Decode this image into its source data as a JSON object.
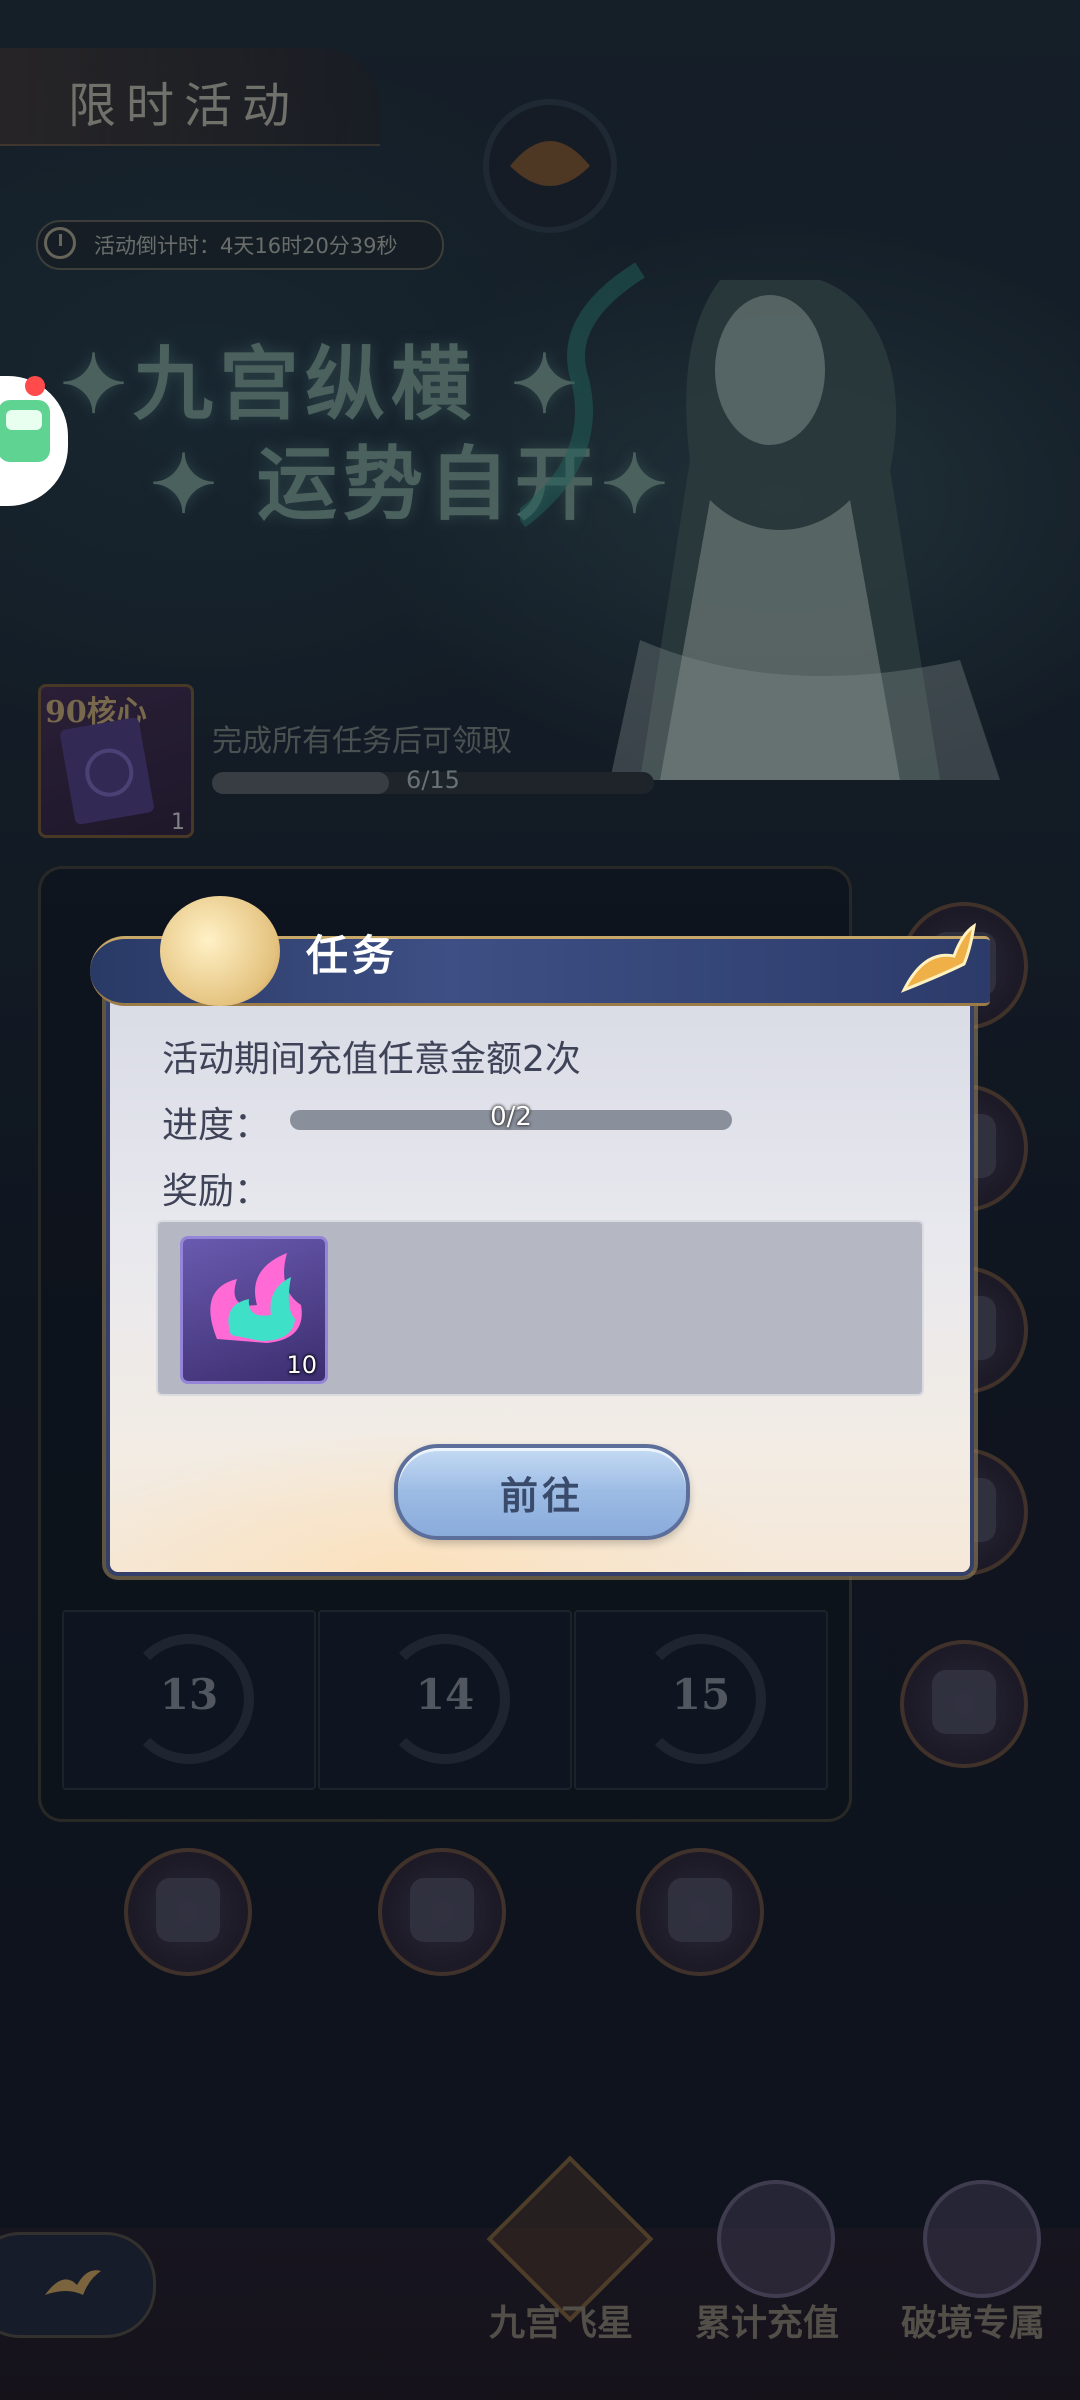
{
  "header": {
    "title": "限时活动",
    "countdown": "活动倒计时：4天16时20分39秒"
  },
  "slogan": {
    "line1": "✦九宫纵横 ✦",
    "line2": "✦ 运势自开✦"
  },
  "core_reward": {
    "label": "90核心",
    "count": "1",
    "description": "完成所有任务后可领取",
    "progress_text": "6/15",
    "progress_fraction": 0.4
  },
  "board": {
    "cells": [
      "13",
      "14",
      "15"
    ]
  },
  "modal": {
    "title": "任务",
    "task_description": "活动期间充值任意金额2次",
    "progress_label": "进度：",
    "progress_text": "0/2",
    "progress_fraction": 0,
    "reward_label": "奖励：",
    "reward_item": {
      "icon": "flame-gem-icon",
      "count": "10"
    },
    "go_button": "前往"
  },
  "nav": {
    "tabs": [
      {
        "label": "九宫飞星",
        "icon": "star-diamond-icon"
      },
      {
        "label": "累计充值",
        "icon": "cloud-treasure-icon"
      },
      {
        "label": "破境专属",
        "icon": "hooded-figure-icon"
      }
    ]
  },
  "colors": {
    "modal_header": "#2a3a66",
    "button": "#9cbbe4",
    "accent_gold": "#c8a868"
  }
}
